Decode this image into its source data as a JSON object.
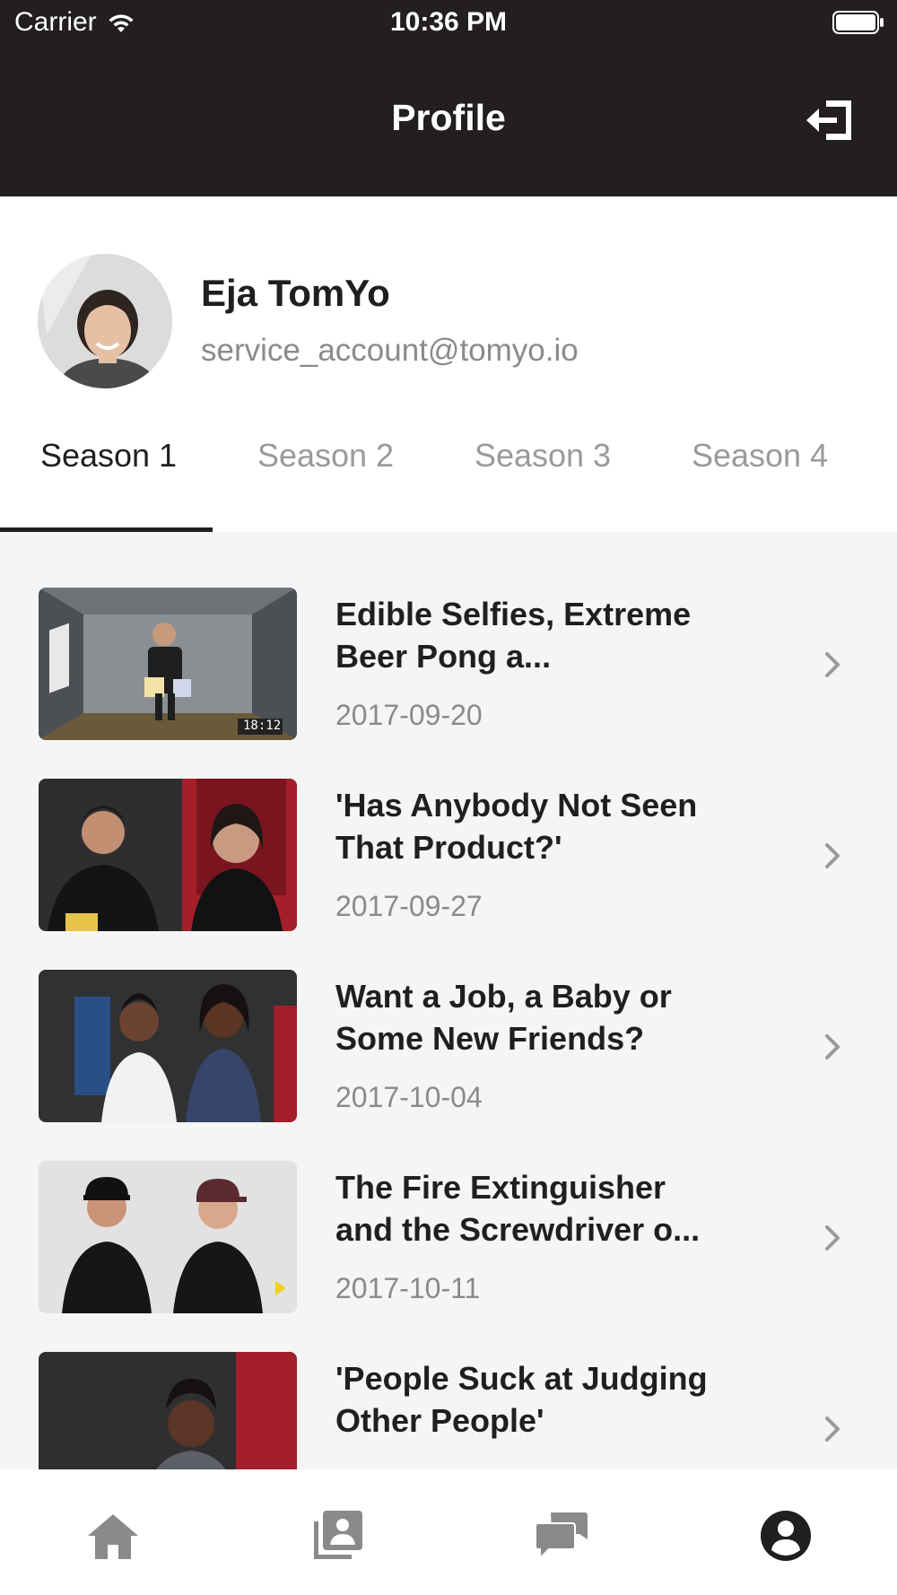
{
  "status_bar": {
    "carrier": "Carrier",
    "time": "10:36 PM"
  },
  "nav": {
    "title": "Profile",
    "logout_icon": "logout-icon"
  },
  "profile": {
    "name": "Eja TomYo",
    "email": "service_account@tomyo.io"
  },
  "tabs": [
    {
      "label": "Season 1",
      "active": true
    },
    {
      "label": "Season 2",
      "active": false
    },
    {
      "label": "Season 3",
      "active": false
    },
    {
      "label": "Season 4",
      "active": false
    }
  ],
  "episodes": [
    {
      "title": "Edible Selfies, Extreme Beer Pong a...",
      "date": "2017-09-20",
      "thumb_timestamp": "18:12"
    },
    {
      "title": "'Has Anybody Not Seen That Product?'",
      "date": "2017-09-27"
    },
    {
      "title": "Want a Job, a Baby or Some New Friends?",
      "date": "2017-10-04"
    },
    {
      "title": "The Fire Extinguisher and the Screwdriver o...",
      "date": "2017-10-11"
    },
    {
      "title": "'People Suck at Judging Other People'",
      "date": ""
    }
  ],
  "tabbar": [
    {
      "icon": "home-icon",
      "active": false
    },
    {
      "icon": "library-icon",
      "active": false
    },
    {
      "icon": "chat-icon",
      "active": false
    },
    {
      "icon": "profile-icon",
      "active": true
    }
  ],
  "colors": {
    "header": "#231f1f",
    "active": "#231f1f",
    "inactive": "#9a9a9a",
    "list_bg": "#f5f5f5"
  }
}
